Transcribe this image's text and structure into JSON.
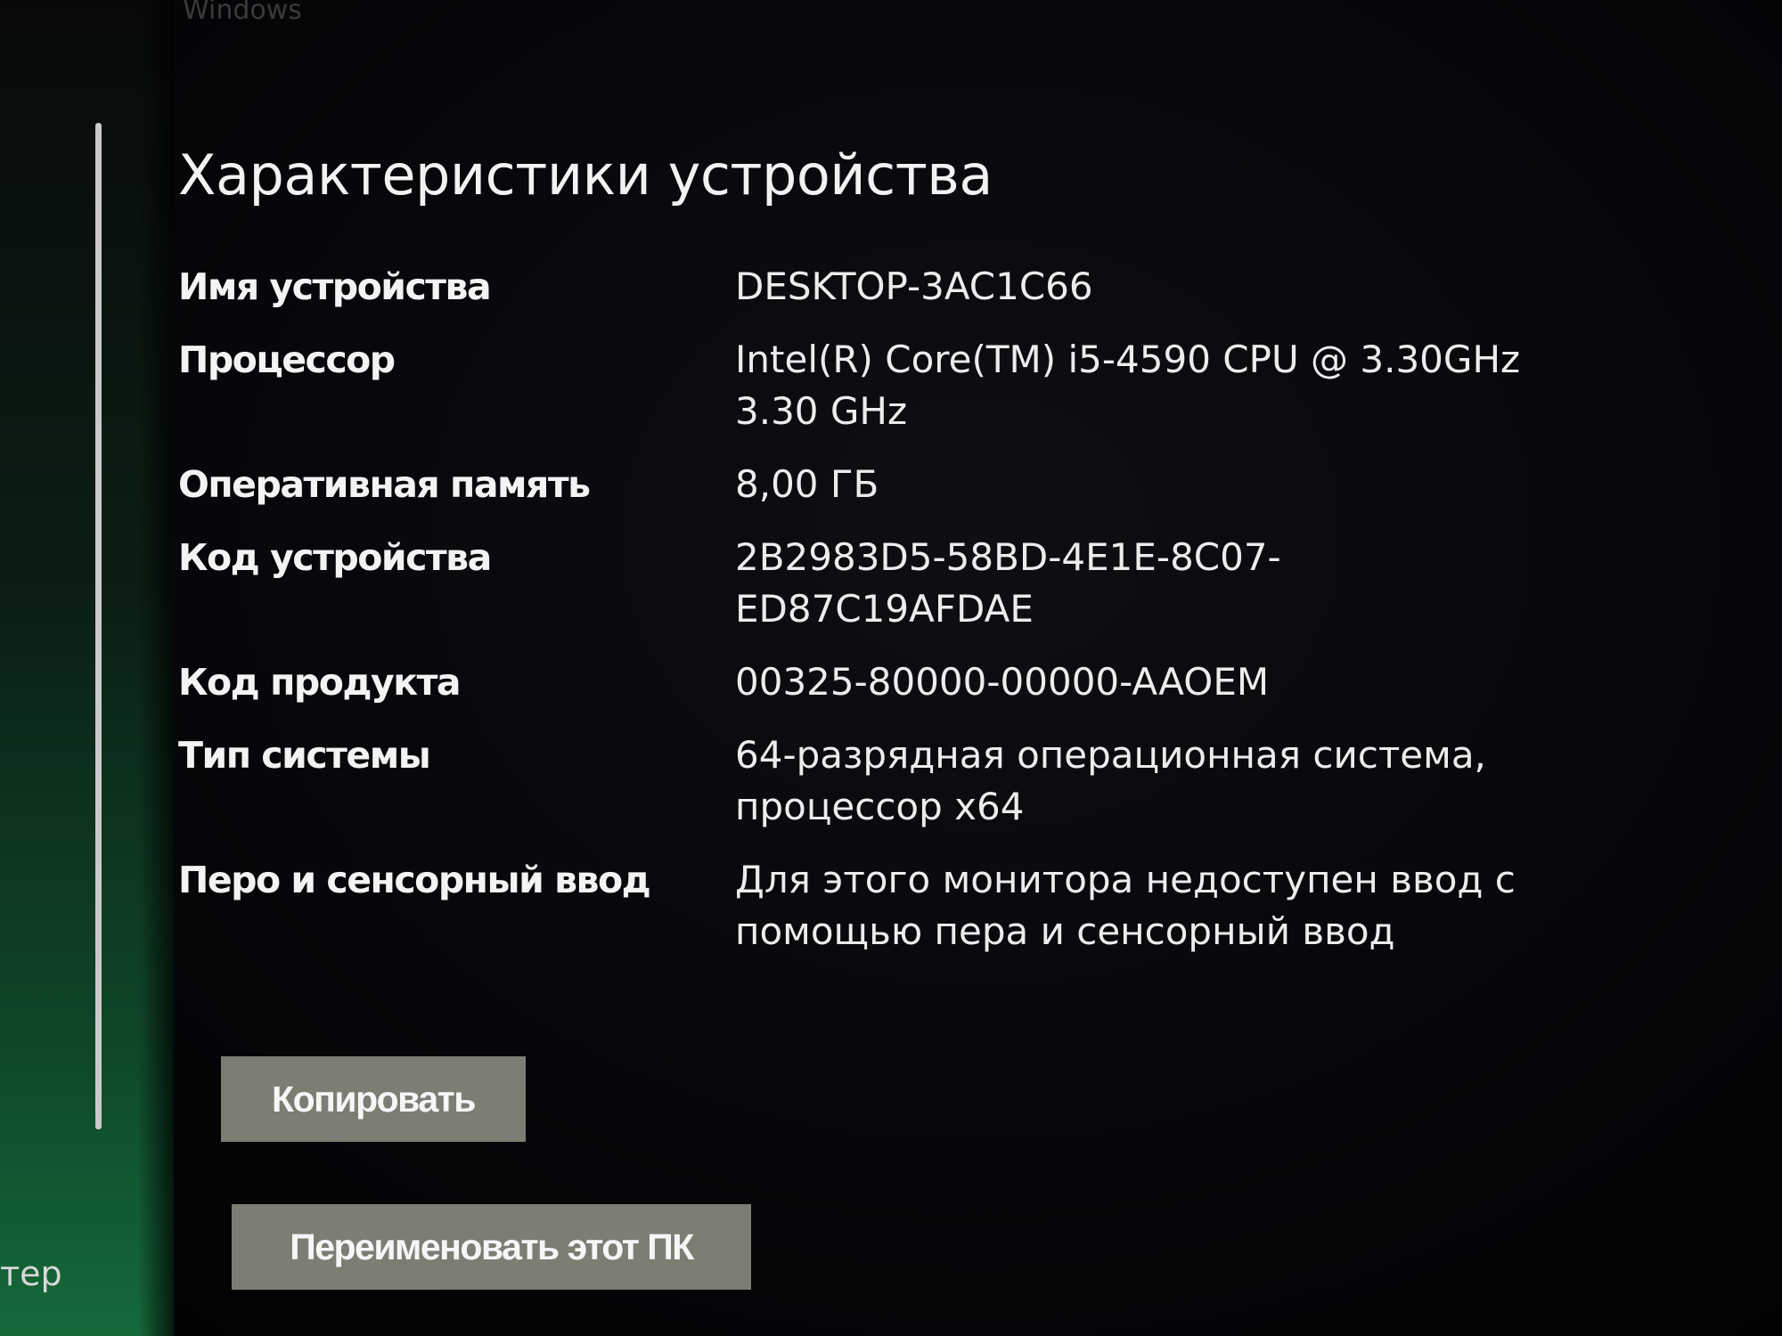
{
  "sidebar": {
    "partial_label": "тер"
  },
  "header": {
    "faded_text": "Windows"
  },
  "section": {
    "title": "Характеристики устройства"
  },
  "specs": [
    {
      "label": "Имя устройства",
      "value": "DESKTOP-3AC1C66"
    },
    {
      "label": "Процессор",
      "value": "Intel(R) Core(TM) i5-4590 CPU @ 3.30GHz\n3.30 GHz"
    },
    {
      "label": "Оперативная память",
      "value": "8,00 ГБ"
    },
    {
      "label": "Код устройства",
      "value": "2B2983D5-58BD-4E1E-8C07-\nED87C19AFDAE"
    },
    {
      "label": "Код продукта",
      "value": "00325-80000-00000-AAOEM"
    },
    {
      "label": "Тип системы",
      "value": "64-разрядная операционная система,\nпроцессор x64"
    },
    {
      "label": "Перо и сенсорный ввод",
      "value": "Для этого монитора недоступен ввод с\nпомощью пера и сенсорный ввод"
    }
  ],
  "buttons": {
    "copy_label": "Копировать",
    "rename_label": "Переименовать этот ПК"
  },
  "colors": {
    "background": "#050608",
    "button_bg": "#7d7d74",
    "accent_green": "#156a3a",
    "text": "#f2f2f2"
  }
}
